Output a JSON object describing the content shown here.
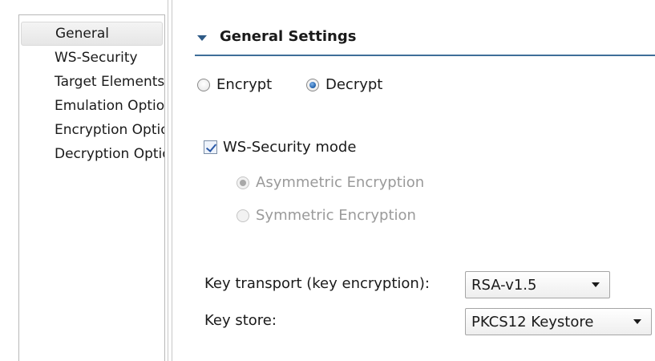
{
  "nav": {
    "items": [
      {
        "label": "General",
        "selected": true
      },
      {
        "label": "WS-Security"
      },
      {
        "label": "Target Elements"
      },
      {
        "label": "Emulation Options"
      },
      {
        "label": "Encryption Options"
      },
      {
        "label": "Decryption Options"
      }
    ]
  },
  "section": {
    "title": "General Settings",
    "expanded": true
  },
  "operation": {
    "encrypt_label": "Encrypt",
    "decrypt_label": "Decrypt",
    "selected": "Decrypt"
  },
  "ws_security": {
    "label": "WS-Security mode",
    "checked": true,
    "asymmetric_label": "Asymmetric Encryption",
    "symmetric_label": "Symmetric Encryption",
    "selected": "Asymmetric Encryption",
    "enabled": false
  },
  "key_transport": {
    "label": "Key transport (key encryption):",
    "value": "RSA-v1.5"
  },
  "key_store": {
    "label": "Key store:",
    "value": "PKCS12 Keystore"
  },
  "icons": {
    "section_toggle": "triangle-down-icon",
    "dropdown_arrow": "chevron-down-icon"
  },
  "colors": {
    "accent": "#3f6e99",
    "disabled_text": "#9a9a9a"
  }
}
